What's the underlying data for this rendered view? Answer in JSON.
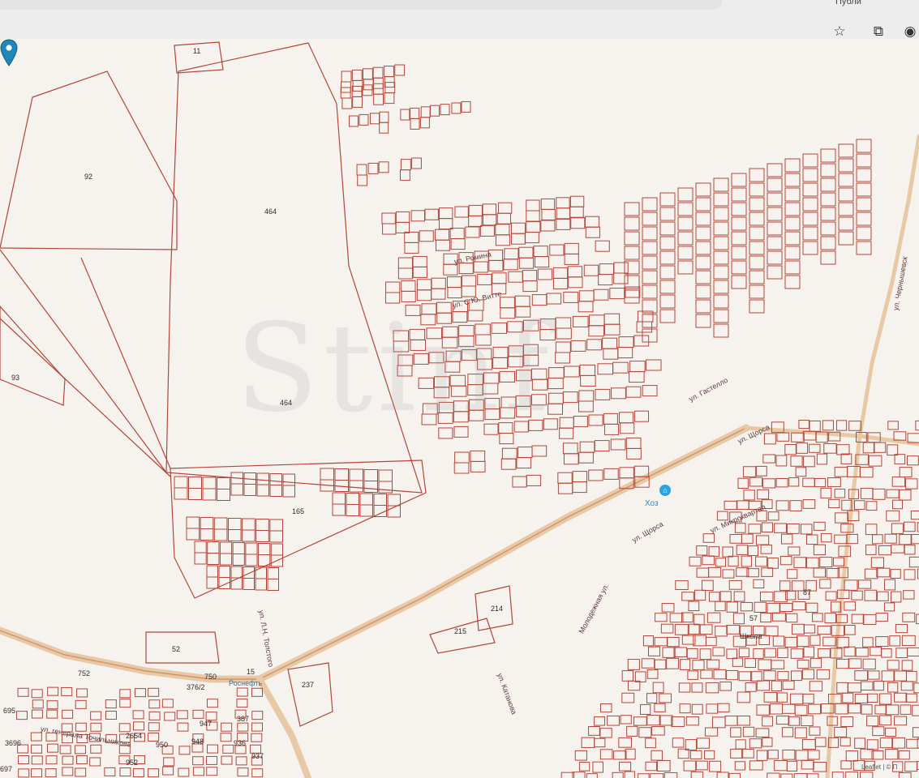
{
  "browser": {
    "tab_label": "Публи",
    "icons": [
      "star-icon",
      "extension-icon",
      "account-icon"
    ]
  },
  "map": {
    "parcels": [
      {
        "id": "p11",
        "label": "11"
      },
      {
        "id": "p92",
        "label": "92"
      },
      {
        "id": "p464a",
        "label": "464"
      },
      {
        "id": "p464b",
        "label": "464"
      },
      {
        "id": "p93",
        "label": "93"
      },
      {
        "id": "p165",
        "label": "165"
      },
      {
        "id": "p52",
        "label": "52"
      },
      {
        "id": "p752",
        "label": "752"
      },
      {
        "id": "p750",
        "label": "750"
      },
      {
        "id": "p376",
        "label": "376/2"
      },
      {
        "id": "p15",
        "label": "15"
      },
      {
        "id": "p387",
        "label": "387"
      },
      {
        "id": "p237",
        "label": "237"
      },
      {
        "id": "p214",
        "label": "214"
      },
      {
        "id": "p215",
        "label": "215"
      },
      {
        "id": "p947",
        "label": "947"
      },
      {
        "id": "p948",
        "label": "948"
      },
      {
        "id": "p936",
        "label": "936"
      },
      {
        "id": "p937",
        "label": "937"
      },
      {
        "id": "p952",
        "label": "952"
      },
      {
        "id": "p950",
        "label": "950"
      },
      {
        "id": "p2654",
        "label": "2654"
      },
      {
        "id": "p3696",
        "label": "3696"
      },
      {
        "id": "p695",
        "label": "695"
      },
      {
        "id": "p697",
        "label": "697"
      },
      {
        "id": "p57",
        "label": "57"
      },
      {
        "id": "p87",
        "label": "87"
      }
    ],
    "streets": [
      {
        "id": "romina",
        "label": "ул. Ромина"
      },
      {
        "id": "vitte",
        "label": "ул. С.Ю. Витте"
      },
      {
        "id": "gastello",
        "label": "ул. Гастелло"
      },
      {
        "id": "shchorsa1",
        "label": "ул. Щорса"
      },
      {
        "id": "shchorsa2",
        "label": "ул. Щорса"
      },
      {
        "id": "mikrokvartal",
        "label": "ул. Микроквартал"
      },
      {
        "id": "tolstogo",
        "label": "ул. Л.Н. Толстого"
      },
      {
        "id": "katanova",
        "label": "ул. Катанова"
      },
      {
        "id": "molodezhnaya",
        "label": "Молодежная ул."
      },
      {
        "id": "chernyshevsk",
        "label": "ул. Чернышевск"
      },
      {
        "id": "tochilnikova",
        "label": "ул. генерала Точильникова"
      }
    ],
    "poi": {
      "label": "Хоз",
      "icon": "shop-icon"
    },
    "school_label": "Школа",
    "rosneft_label": "Роснефть",
    "watermark": "Stinf",
    "attribution": "Leaflet | © П",
    "colors": {
      "parcel_stroke": "#b5453a",
      "road": "#e0b48a",
      "marker": "#1e88b8"
    }
  }
}
